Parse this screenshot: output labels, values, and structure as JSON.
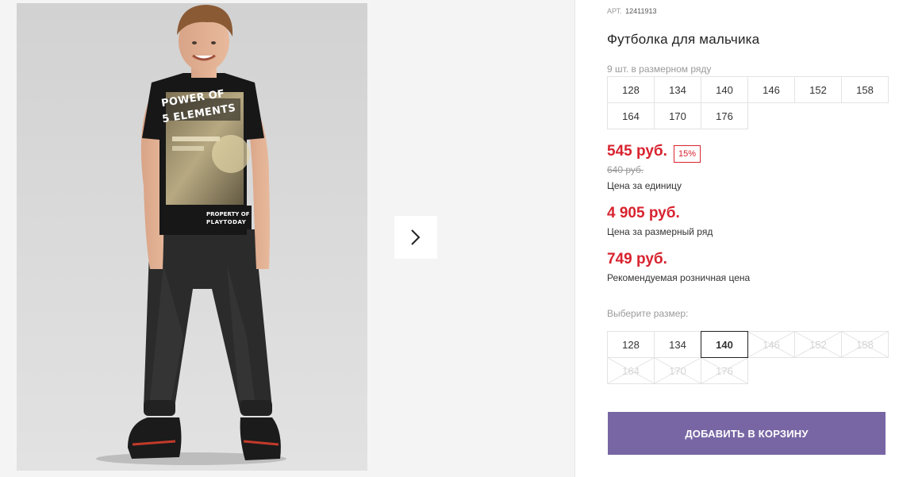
{
  "product": {
    "article_label": "АРТ.",
    "article_value": "12411913",
    "title": "Футболка для мальчика",
    "image": {
      "print_line1": "POWER OF",
      "print_line2": "5 ELEMENTS",
      "print_line3": "PROPERTY OF",
      "print_brand": "PLAYTODAY"
    }
  },
  "pack": {
    "label": "9 шт. в размерном ряду",
    "sizes": [
      "128",
      "134",
      "140",
      "146",
      "152",
      "158",
      "164",
      "170",
      "176"
    ]
  },
  "prices": {
    "unit_price": "545 руб.",
    "discount": "15%",
    "old_price": "640 руб.",
    "unit_label": "Цена за единицу",
    "pack_price": "4 905 руб.",
    "pack_label": "Цена за размерный ряд",
    "rrp_price": "749 руб.",
    "rrp_label": "Рекомендуемая розничная цена"
  },
  "size_select": {
    "label": "Выберите размер:",
    "selected": "140",
    "options": [
      {
        "size": "128",
        "available": true
      },
      {
        "size": "134",
        "available": true
      },
      {
        "size": "140",
        "available": true
      },
      {
        "size": "146",
        "available": false
      },
      {
        "size": "152",
        "available": false
      },
      {
        "size": "158",
        "available": false
      },
      {
        "size": "164",
        "available": false
      },
      {
        "size": "170",
        "available": false
      },
      {
        "size": "176",
        "available": false
      }
    ]
  },
  "cart": {
    "button_label": "ДОБАВИТЬ В КОРЗИНУ"
  },
  "gallery": {
    "next_icon": "chevron-right-icon"
  },
  "colors": {
    "price_red": "#d8232f",
    "button_purple": "#7866a4",
    "page_bg": "#f4f4f4"
  }
}
